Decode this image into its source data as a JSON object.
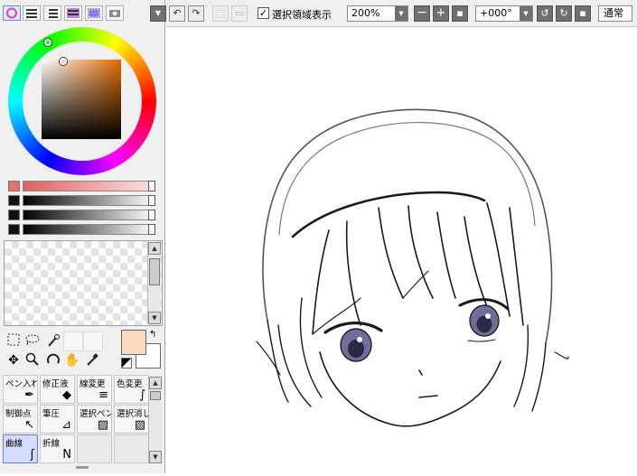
{
  "toolbar": {
    "show_selection_label": "選択領域表示",
    "show_selection_checked": true,
    "zoom_value": "200%",
    "rotation_value": "+000°",
    "blend_mode": "通常"
  },
  "colors": {
    "foreground": "#f9d9bd",
    "background": "#ffffff",
    "selected_tool_bg": "#d4ddff"
  },
  "tools": {
    "icons": [
      "selection-rect-icon",
      "lasso-icon",
      "magic-wand-icon",
      "move-icon",
      "zoom-icon",
      "rotate-icon",
      "hand-icon",
      "eyedropper-icon"
    ],
    "vector_tools": [
      {
        "label": "ペン入れ",
        "icon": "pen-icon",
        "selected": false
      },
      {
        "label": "修正液",
        "icon": "eraser-icon",
        "selected": false
      },
      {
        "label": "線変更",
        "icon": "line-change-icon",
        "selected": false
      },
      {
        "label": "色変更",
        "icon": "color-change-icon",
        "selected": false
      },
      {
        "label": "制御点",
        "icon": "control-point-icon",
        "selected": false
      },
      {
        "label": "筆圧",
        "icon": "pressure-icon",
        "selected": false
      },
      {
        "label": "選択ペン",
        "icon": "select-pen-icon",
        "selected": false
      },
      {
        "label": "選択消し",
        "icon": "select-erase-icon",
        "selected": false
      },
      {
        "label": "曲線",
        "icon": "curve-icon",
        "selected": true
      },
      {
        "label": "折線",
        "icon": "polyline-icon",
        "selected": false
      }
    ]
  }
}
